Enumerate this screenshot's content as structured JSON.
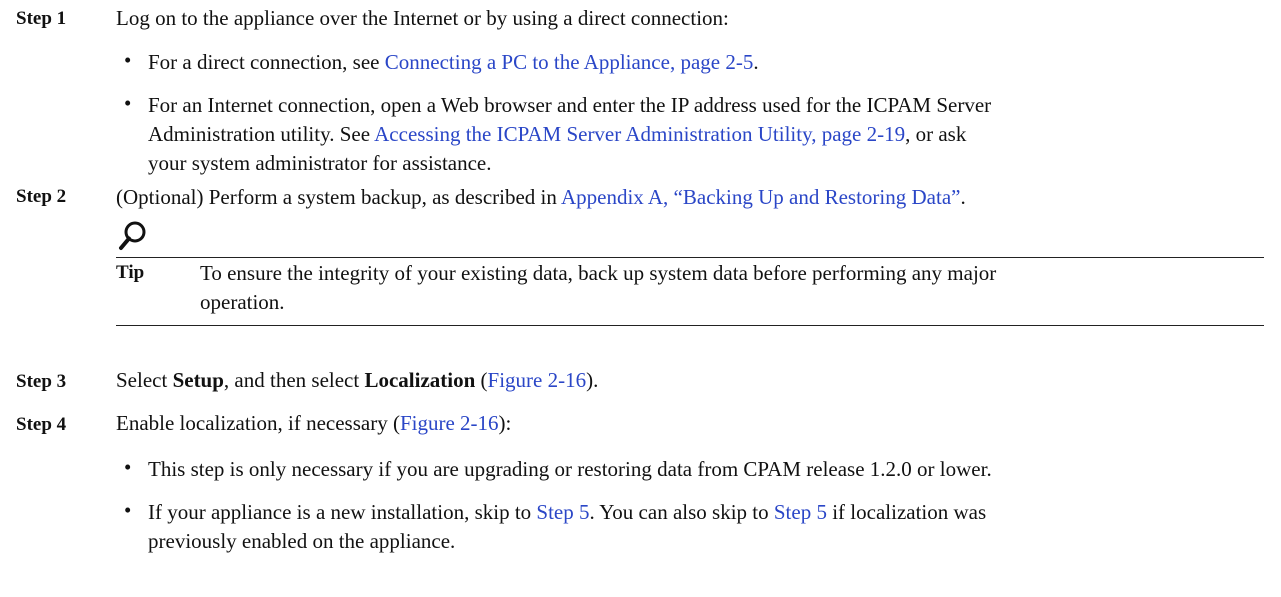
{
  "step1": {
    "label": "Step 1",
    "text": "Log on to the appliance over the Internet or by using a direct connection:",
    "bullet1": {
      "pre": "For a direct connection, see ",
      "link": "Connecting a PC to the Appliance, page 2-5",
      "post": "."
    },
    "bullet2": {
      "line1": "For an Internet connection, open a Web browser and enter the IP address used for the ICPAM Server",
      "line2_pre": "Administration utility. See ",
      "line2_link": "Accessing the ICPAM Server Administration Utility, page 2-19",
      "line2_post": ", or ask",
      "line3": "your system administrator for assistance."
    }
  },
  "step2": {
    "label": "Step 2",
    "pre": "(Optional) Perform a system backup, as described in ",
    "link": "Appendix A, “Backing Up and Restoring Data”",
    "post": "."
  },
  "tip": {
    "label": "Tip",
    "line1": "To ensure the integrity of your existing data, back up system data before performing any major",
    "line2": "operation."
  },
  "step3": {
    "label": "Step 3",
    "pre": "Select ",
    "bold1": "Setup",
    "mid": ", and then select ",
    "bold2": "Localization",
    "open": " (",
    "link": "Figure 2-16",
    "close": ")."
  },
  "step4": {
    "label": "Step 4",
    "pre": "Enable localization, if necessary (",
    "link": "Figure 2-16",
    "post": "):",
    "bullet1": "This step is only necessary if you are upgrading or restoring data from CPAM release 1.2.0 or lower.",
    "bullet2": {
      "pre": "If your appliance is a new installation, skip to ",
      "link1": "Step 5",
      "mid": ". You can also skip to ",
      "link2": "Step 5",
      "post": " if localization was",
      "line2": "previously enabled on the appliance."
    }
  },
  "bullet_char": "•"
}
